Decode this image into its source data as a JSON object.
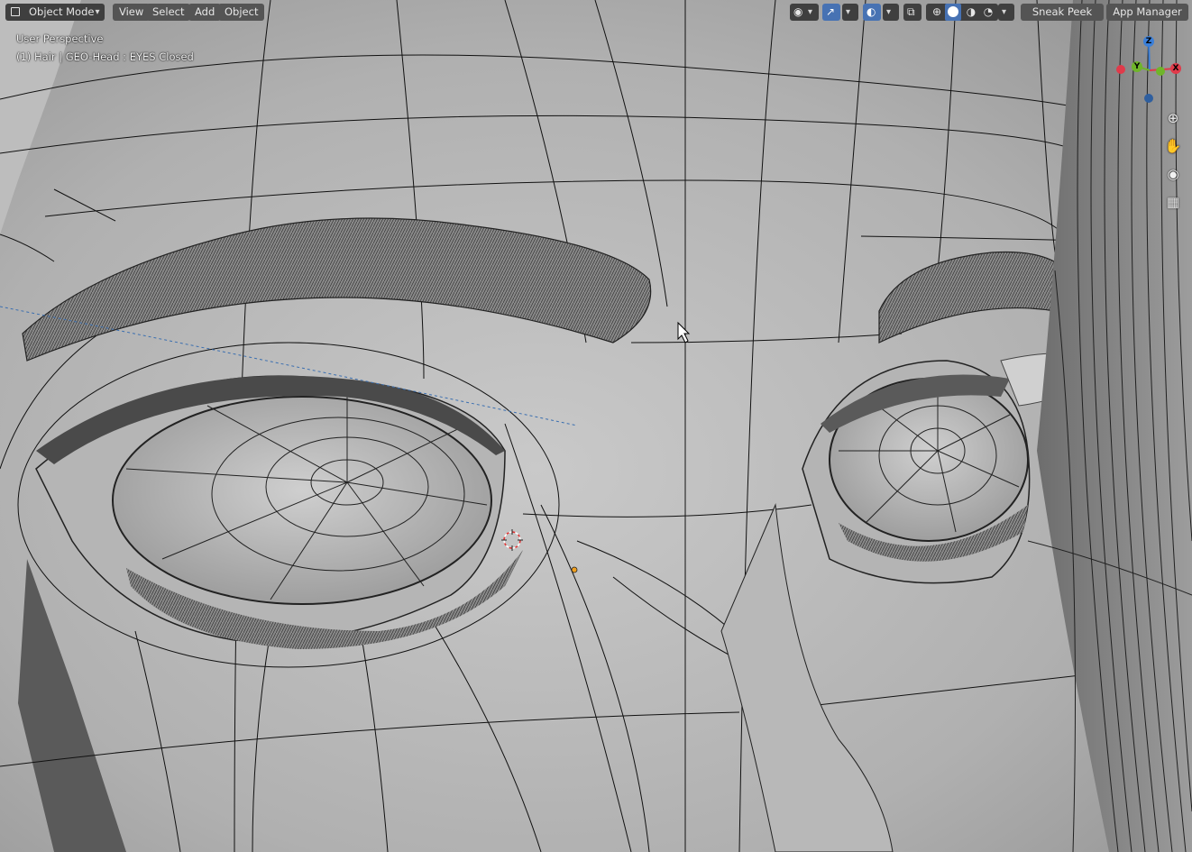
{
  "header": {
    "mode_label": "Object Mode",
    "menus": [
      "View",
      "Select",
      "Add",
      "Object"
    ],
    "sneak_peek_label": "Sneak Peek",
    "app_manager_label": "App Manager"
  },
  "overlay": {
    "view_name": "User Perspective",
    "object_info": "(1) Hair | GEO-Head : EYES Closed"
  },
  "gizmo": {
    "z_label": "Z",
    "y_label": "Y",
    "x_label": "X",
    "colors": {
      "x": "#e03a4a",
      "y": "#6fb52a",
      "z": "#3a7fd9"
    }
  },
  "icons": {
    "mode": "object-mode-icon",
    "visibility": "visibility-icon",
    "gizmo": "gizmo-toggle-icon",
    "overlay": "overlay-toggle-icon",
    "xray": "xray-icon",
    "shading": [
      "wireframe-shading-icon",
      "solid-shading-icon",
      "material-shading-icon",
      "rendered-shading-icon"
    ],
    "nav_tools": [
      "zoom-icon",
      "pan-icon",
      "camera-icon",
      "grid-icon"
    ]
  }
}
